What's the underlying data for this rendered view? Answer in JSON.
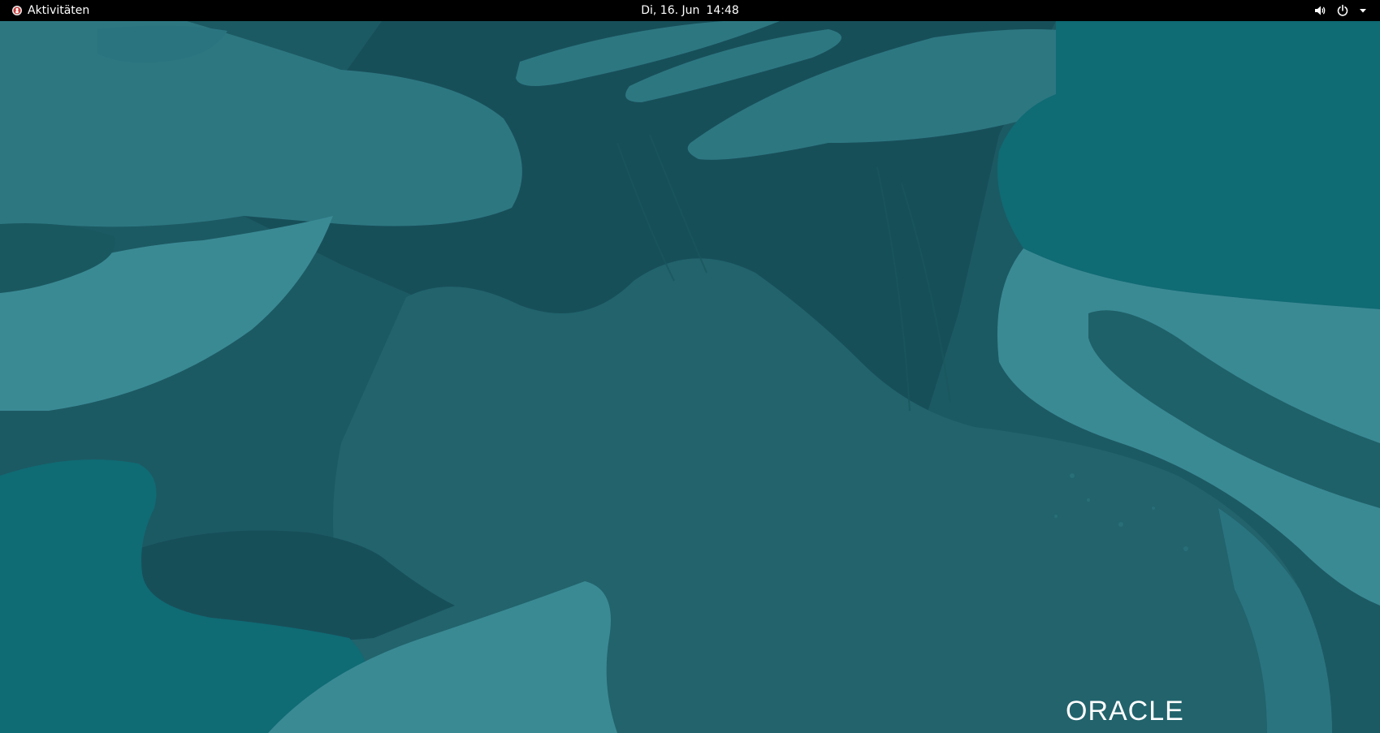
{
  "topbar": {
    "activities_label": "Aktivitäten",
    "clock_date": "Di, 16. Jun",
    "clock_time": "14:48",
    "icons": {
      "activities": "distro-logo-icon",
      "volume": "volume-icon",
      "power": "power-icon",
      "menu": "chevron-down-icon"
    }
  },
  "desktop": {
    "wallpaper": "oracle-teal-abstract",
    "logo_text": "ORACLE",
    "colors": {
      "base": "#1c5a63",
      "dark": "#174f59",
      "mid": "#2a7480",
      "light": "#3b8d97",
      "teal": "#0d6a73"
    }
  }
}
